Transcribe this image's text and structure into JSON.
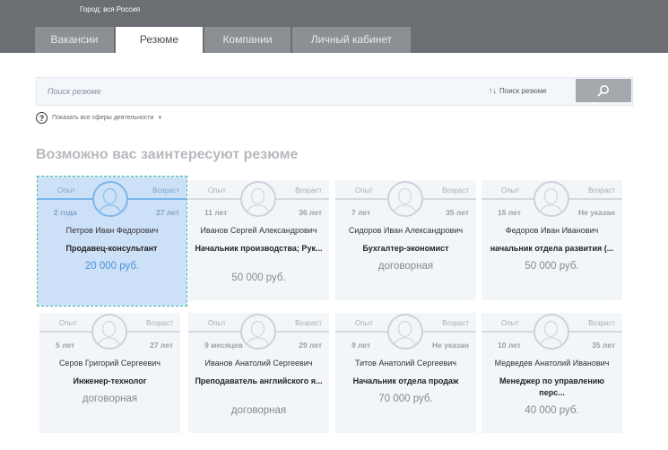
{
  "header": {
    "city": "Город: вся Россия",
    "tabs": [
      {
        "label": "Вакансии",
        "active": false
      },
      {
        "label": "Резюме",
        "active": true
      },
      {
        "label": "Компании",
        "active": false
      },
      {
        "label": "Личный кабинет",
        "active": false
      }
    ]
  },
  "search": {
    "placeholder": "Поиск резюме",
    "sort_label": "Поиск резюме",
    "button_icon": "search-icon"
  },
  "filters": {
    "spheres_label": "Показать все сферы деятельности"
  },
  "section_title": "Возможно вас заинтересуют резюме",
  "labels": {
    "experience": "Опыт",
    "age": "Возраст"
  },
  "resumes": [
    {
      "experience": "2 года",
      "age": "27 лет",
      "name": "Петров Иван Федорович",
      "position": "Продавец-консультант",
      "salary": "20 000 руб.",
      "selected": true
    },
    {
      "experience": "11 лет",
      "age": "36 лет",
      "name": "Иванов Сергей Александрович",
      "position": "Начальник производства; Рук...",
      "salary": "50 000 руб.",
      "selected": false
    },
    {
      "experience": "7 лет",
      "age": "35 лет",
      "name": "Сидоров Иван Александрович",
      "position": "Бухгалтер-экономист",
      "salary": "договорная",
      "selected": false
    },
    {
      "experience": "15 лет",
      "age": "Не указан",
      "name": "Федоров Иван Иванович",
      "position": "начальник отдела развития (...",
      "salary": "50 000 руб.",
      "selected": false
    },
    {
      "experience": "5 лет",
      "age": "27 лет",
      "name": "Серов Григорий Сергеевич",
      "position": "Инженер-технолог",
      "salary": "договорная",
      "selected": false
    },
    {
      "experience": "9 месяцев",
      "age": "29 лет",
      "name": "Иванов Анатолий Сергеевич",
      "position": "Преподаватель английского я...",
      "salary": "договорная",
      "selected": false
    },
    {
      "experience": "9 лет",
      "age": "Не указан",
      "name": "Титов Анатолий Сергеевич",
      "position": "Начальник отдела продаж",
      "salary": "70 000 руб.",
      "selected": false
    },
    {
      "experience": "10 лет",
      "age": "35 лет",
      "name": "Медведев Анатолий Иванович",
      "position": "Менеджер по управлению перс...",
      "salary": "40 000 руб.",
      "selected": false
    }
  ]
}
